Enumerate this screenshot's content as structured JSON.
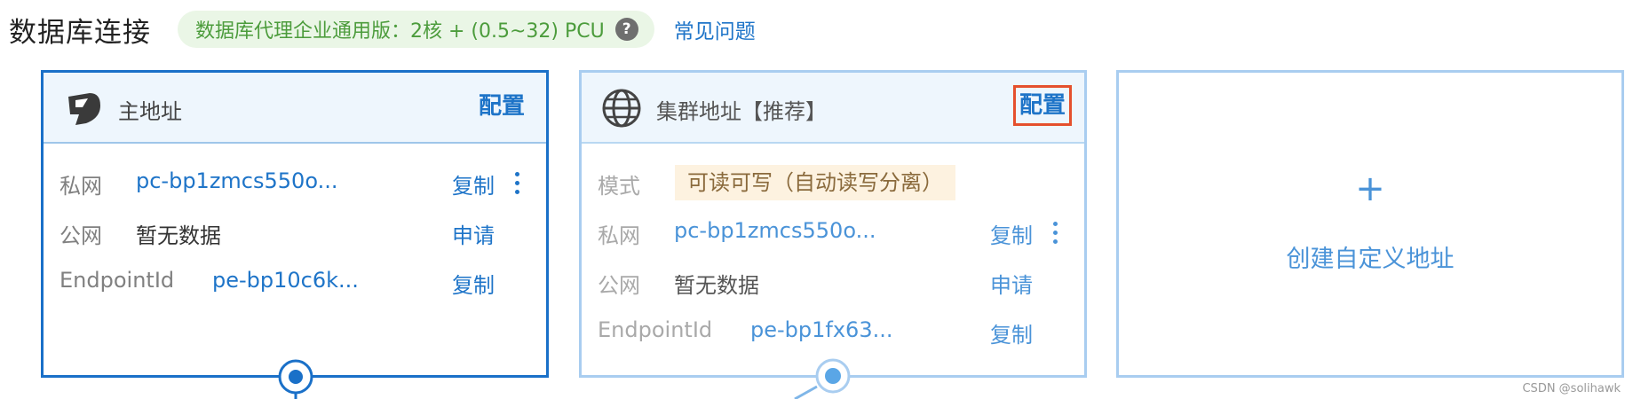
{
  "header": {
    "title": "数据库连接",
    "edition_badge": "数据库代理企业通用版：2核 + (0.5~32) PCU",
    "help_icon_glyph": "?",
    "faq_link": "常见问题"
  },
  "cards": {
    "primary": {
      "title": "主地址",
      "action": "配置",
      "rows": [
        {
          "label": "私网",
          "value": "pc-bp1zmcs550o...",
          "action": "复制"
        },
        {
          "label": "公网",
          "value": "暂无数据",
          "action": "申请"
        },
        {
          "label": "EndpointId",
          "value": "pe-bp10c6k...",
          "action": "复制"
        }
      ]
    },
    "cluster": {
      "title": "集群地址【推荐】",
      "action": "配置",
      "mode_label": "模式",
      "mode_value": "可读可写（自动读写分离）",
      "rows": [
        {
          "label": "私网",
          "value": "pc-bp1zmcs550o...",
          "action": "复制"
        },
        {
          "label": "公网",
          "value": "暂无数据",
          "action": "申请"
        },
        {
          "label": "EndpointId",
          "value": "pe-bp1fx63...",
          "action": "复制"
        }
      ]
    },
    "custom": {
      "plus": "+",
      "label": "创建自定义地址"
    }
  },
  "watermark": "CSDN @solihawk",
  "colors": {
    "primary_border": "#1a70c8",
    "secondary_border": "#a9cdf0",
    "link": "#1e74c8",
    "highlight": "#e5502d",
    "badge_bg": "#eaf6e6",
    "badge_text": "#4c9c3c"
  }
}
